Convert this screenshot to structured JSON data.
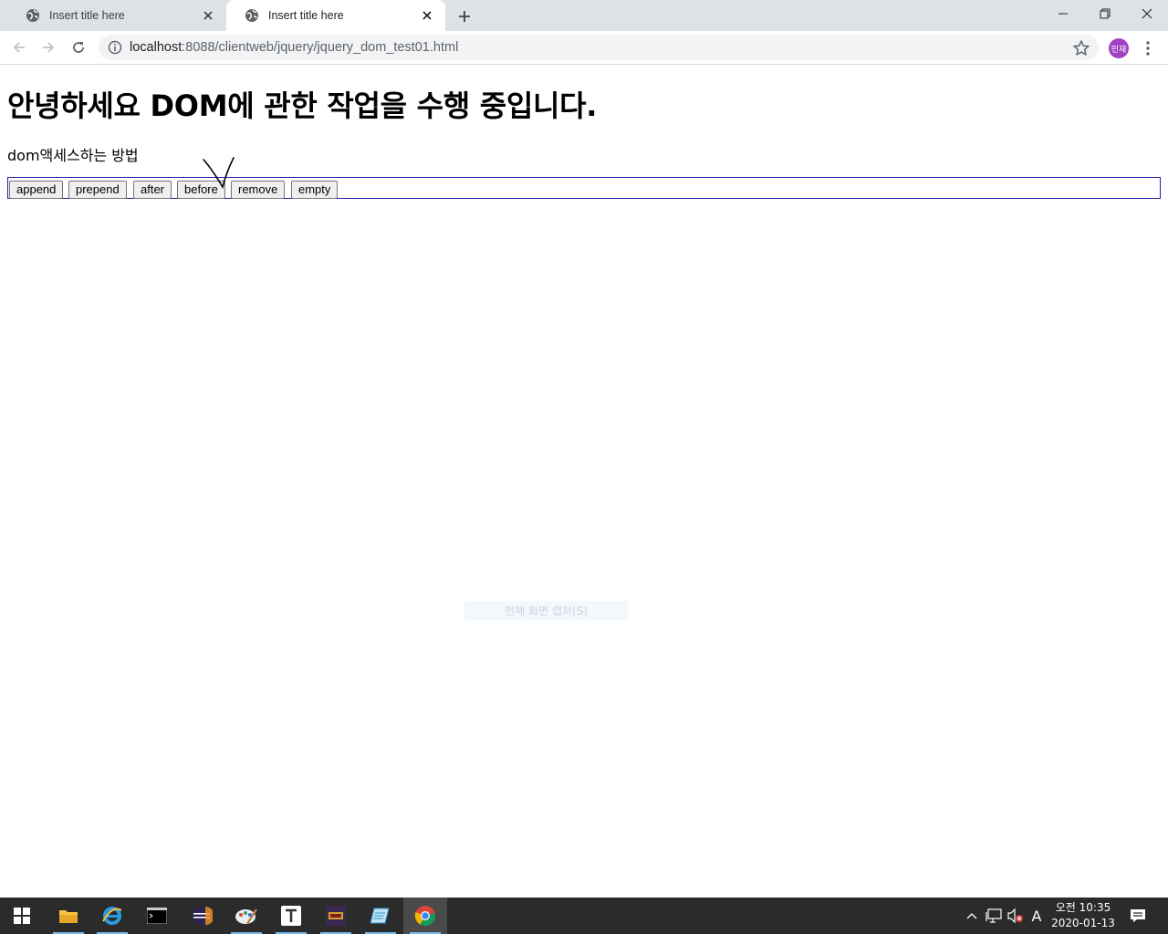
{
  "browser": {
    "tabs": [
      {
        "title": "Insert title here",
        "active": false
      },
      {
        "title": "Insert title here",
        "active": true
      }
    ],
    "url": {
      "host": "localhost",
      "path": ":8088/clientweb/jquery/jquery_dom_test01.html"
    },
    "profile_initials": "민재"
  },
  "page": {
    "heading": "안녕하세요 DOM에 관한 작업을 수행 중입니다.",
    "subtitle": "dom액세스하는 방법",
    "buttons": [
      "append",
      "prepend",
      "after",
      "before",
      "remove",
      "empty"
    ],
    "capture_tooltip": "전체 화면 캡처(S)"
  },
  "taskbar": {
    "apps": [
      "file-explorer",
      "internet-explorer",
      "command-prompt",
      "eclipse",
      "paint",
      "typora",
      "game",
      "notepad",
      "chrome"
    ],
    "active_app": "chrome",
    "ime_indicator": "A",
    "time": "오전 10:35",
    "date": "2020-01-13"
  },
  "colors": {
    "tabstrip": "#dee1e6",
    "button_box_border": "#1a1aa6",
    "avatar": "#a142c4",
    "taskbar": "#2b2b2b"
  }
}
